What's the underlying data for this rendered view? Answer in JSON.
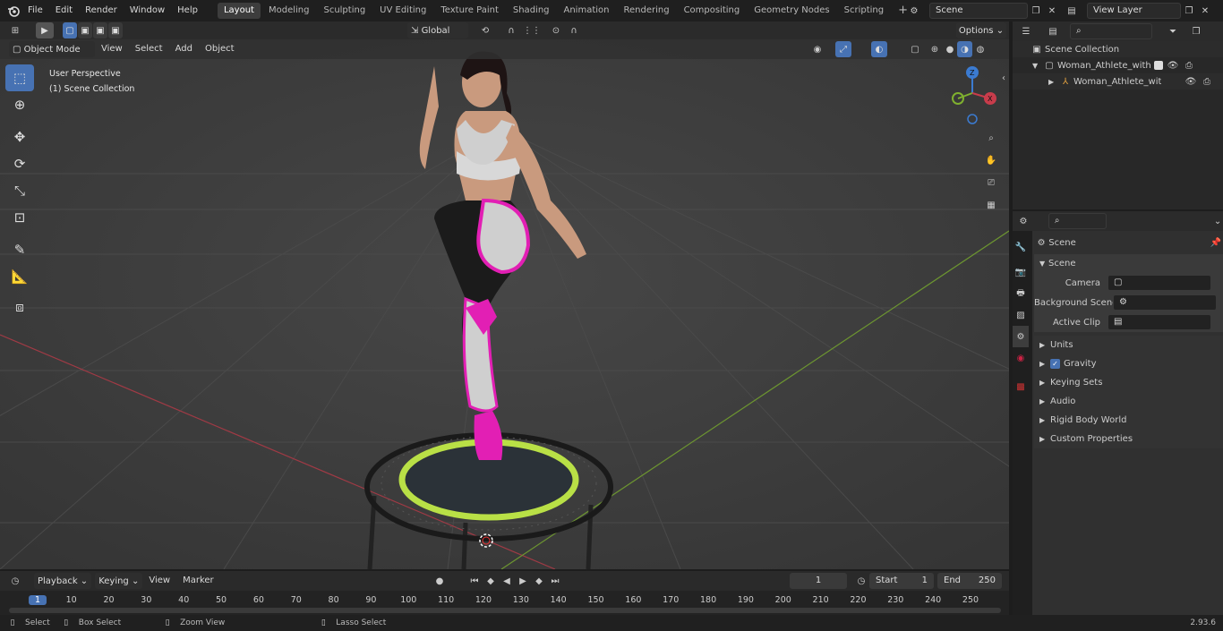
{
  "menus": [
    "File",
    "Edit",
    "Render",
    "Window",
    "Help"
  ],
  "workspaces": [
    "Layout",
    "Modeling",
    "Sculpting",
    "UV Editing",
    "Texture Paint",
    "Shading",
    "Animation",
    "Rendering",
    "Compositing",
    "Geometry Nodes",
    "Scripting"
  ],
  "active_workspace": "Layout",
  "scene_field": "Scene",
  "view_layer_field": "View Layer",
  "toolheader": {
    "transform_orientation": "Global",
    "options": "Options"
  },
  "viewport_header": {
    "mode": "Object Mode",
    "menus": [
      "View",
      "Select",
      "Add",
      "Object"
    ]
  },
  "viewport_overlay": {
    "perspective": "User Perspective",
    "collection": "(1) Scene Collection"
  },
  "gizmo": {
    "z": "Z",
    "y": "Y",
    "x": "X"
  },
  "outliner": {
    "root": "Scene Collection",
    "items": [
      {
        "label": "Woman_Athlete_with_Trampoline"
      },
      {
        "label": "Woman_Athlete_with_Trampoline"
      }
    ]
  },
  "properties": {
    "header": "Scene",
    "section": "Scene",
    "fields": [
      {
        "label": "Camera"
      },
      {
        "label": "Background Scene"
      },
      {
        "label": "Active Clip"
      }
    ],
    "panels": [
      "Units",
      "Gravity",
      "Keying Sets",
      "Audio",
      "Rigid Body World",
      "Custom Properties"
    ]
  },
  "timeline": {
    "menus": [
      "Playback",
      "Keying",
      "View",
      "Marker"
    ],
    "current_frame": "1",
    "start_label": "Start",
    "start": "1",
    "end_label": "End",
    "end": "250",
    "ticks": [
      "1",
      "10",
      "20",
      "30",
      "40",
      "50",
      "60",
      "70",
      "80",
      "90",
      "100",
      "110",
      "120",
      "130",
      "140",
      "150",
      "160",
      "170",
      "180",
      "190",
      "200",
      "210",
      "220",
      "230",
      "240",
      "250"
    ]
  },
  "status": {
    "select": "Select",
    "box_select": "Box Select",
    "zoom_view": "Zoom View",
    "lasso_select": "Lasso Select",
    "version": "2.93.6"
  },
  "colors": {
    "accent": "#4772b3",
    "xaxis": "#c83c4b",
    "yaxis": "#7fb02f",
    "zaxis": "#3b7bd1"
  }
}
